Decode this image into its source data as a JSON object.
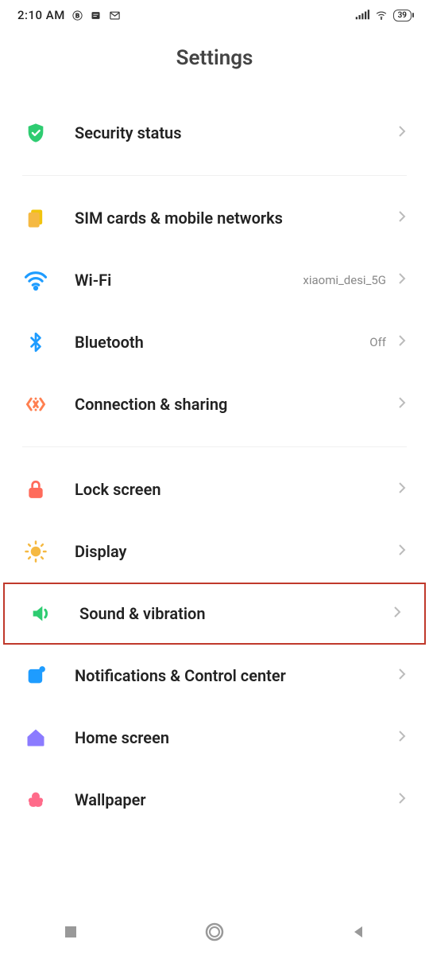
{
  "status": {
    "time": "2:10 AM",
    "battery": "39"
  },
  "title": "Settings",
  "items": {
    "security": {
      "label": "Security status"
    },
    "sim": {
      "label": "SIM cards & mobile networks"
    },
    "wifi": {
      "label": "Wi-Fi",
      "value": "xiaomi_desi_5G"
    },
    "bluetooth": {
      "label": "Bluetooth",
      "value": "Off"
    },
    "connshare": {
      "label": "Connection & sharing"
    },
    "lock": {
      "label": "Lock screen"
    },
    "display": {
      "label": "Display"
    },
    "sound": {
      "label": "Sound & vibration"
    },
    "notif": {
      "label": "Notifications & Control center"
    },
    "home": {
      "label": "Home screen"
    },
    "wallpaper": {
      "label": "Wallpaper"
    }
  }
}
